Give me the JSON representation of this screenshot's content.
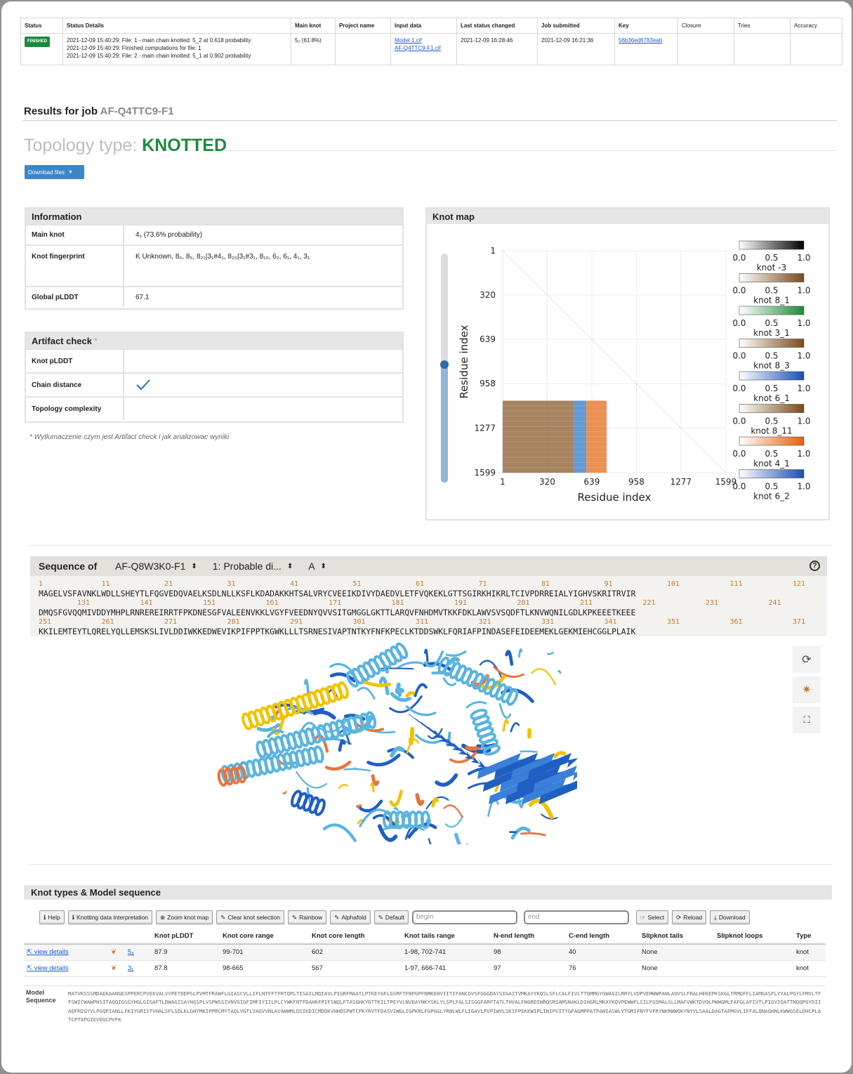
{
  "status_table": {
    "headers": [
      "Status",
      "Status Details",
      "Main knot",
      "Project name",
      "Input data",
      "Last status changed",
      "Job submitted",
      "Key",
      "Closure",
      "Tries",
      "Accuracy"
    ],
    "row": {
      "status": "FINISHED",
      "details": [
        "2021-12-09 15:40:29: File: 1 - main chain knotted: 5_2 at 0.618 probability",
        "2021-12-09 15:40:29: Finished computations for file: 1",
        "2021-12-09 15:40:29: File: 2 - main chain knotted: 5_1 at 0.902 probability"
      ],
      "main_knot": "5₂ (61.8%)",
      "project_name": "",
      "input_1": "Model 1.cif",
      "input_2": "AF-Q4TTC9-F1.cif",
      "last_changed": "2021-12-09 16:28:46",
      "submitted": "2021-12-09 16:21:36",
      "key": "56b36ed6783eab"
    }
  },
  "results": {
    "title": "Results for job",
    "job_id": "AF-Q4TTC9-F1",
    "topology_label": "Topology type:",
    "topology_value": "KNOTTED",
    "download_label": "Download files"
  },
  "information": {
    "title": "Information",
    "main_knot_label": "Main knot",
    "main_knot_value": "4₁ (73.6% probability)",
    "fingerprint_label": "Knot fingerprint",
    "fingerprint_value": "K Unknown, 8₆, 8₅, 8₂₁|3₁#4₁, 8₂₀|3₁#3₁, 8₁₀, 6₂, 6₁, 4₁, 3₁",
    "plddt_label": "Global pLDDT",
    "plddt_value": "67.1"
  },
  "artifact": {
    "title": "Artifact check",
    "star": "*",
    "rows": [
      "Knot pLDDT",
      "Chain distance",
      "Topology complexity"
    ],
    "note": "* Wytłumaczenie czym jest Artifact check i jak analizowac wyniki"
  },
  "knot_map": {
    "title": "Knot map",
    "colorbars": [
      "knot -3",
      "knot 8_1",
      "knot 3_1",
      "knot 8_3",
      "knot 6_1",
      "knot 8_11",
      "knot 4_1",
      "knot 6_2"
    ],
    "colorbar_ticks": [
      "0.0",
      "0.5",
      "1.0"
    ],
    "colorbar_colors": [
      "#000000",
      "#7a4a1e",
      "#1f8a3c",
      "#7a4a1e",
      "#1a4fb0",
      "#7a4a1e",
      "#e0620d",
      "#1a4fb0"
    ]
  },
  "chart_data": {
    "type": "heatmap",
    "xlabel": "Residue index",
    "ylabel": "Residue index",
    "xticks": [
      "1",
      "320",
      "639",
      "958",
      "1277",
      "1599"
    ],
    "yticks": [
      "1",
      "320",
      "639",
      "958",
      "1277",
      "1599"
    ],
    "xlim": [
      1,
      1599
    ],
    "ylim": [
      1,
      1599
    ],
    "regions": [
      {
        "knot": "knot 8_1",
        "x": [
          1,
          510
        ],
        "y": [
          1080,
          1599
        ],
        "color": "#8a5a2b"
      },
      {
        "knot": "knot 6_1",
        "x": [
          510,
          600
        ],
        "y": [
          1080,
          1599
        ],
        "color": "#2f78c4"
      },
      {
        "knot": "knot 4_1",
        "x": [
          600,
          745
        ],
        "y": [
          1080,
          1599
        ],
        "color": "#e56a1a"
      }
    ]
  },
  "sequence_viewer": {
    "label": "Sequence of",
    "entry": "AF-Q8W3K0-F1",
    "chain_desc": "1: Probable di...",
    "chain": "A",
    "help": "?",
    "rows": [
      {
        "nums": [
          "1",
          "11",
          "21",
          "31",
          "41",
          "51",
          "61",
          "71",
          "81",
          "91",
          "101",
          "111",
          "121"
        ],
        "seq": "MAGELVSFAVNKLWDLLSHEYTLFQGVEDQVAELKSDLNLLKSFLKDADAKKHTSALVRYCVEEIKDIVYDAEDVLETFVQKEKLGTTSGIRKHIKRLTCIVPDRREIALYIGHVSKRITRVIR"
      },
      {
        "nums": [
          "131",
          "141",
          "151",
          "161",
          "171",
          "181",
          "191",
          "201",
          "211",
          "221",
          "231",
          "241"
        ],
        "seq": "DMQSFGVQQMIVDDYMHPLRNREREIRRTFPKDNESGFVALEENVKKLVGYFVEEDNYQVVSITGMGGLGKTTLARQVFNHDMVTKKFDKLAWVSVSQDFTLKNVWQNILGDLKPKEEETKEEE"
      },
      {
        "nums": [
          "251",
          "261",
          "271",
          "281",
          "291",
          "301",
          "311",
          "321",
          "331",
          "341",
          "351",
          "361",
          "371"
        ],
        "seq": "KKILEMTEYTLQRELYQLLEMSKSLIVLDDIWKKEDWEVIKPIFPPTKGWKLLLTSRNESIVAPTNTKYFNFKPECLKTDDSWKLFQRIAFPINDASEFEIDEEMEKLGEKMIEHCGGLPLAIK"
      }
    ]
  },
  "knot_types": {
    "title": "Knot types & Model sequence",
    "buttons": [
      "Help",
      "Knotting data interpretation",
      "Zoom knot map",
      "Clear knot selection",
      "Rainbow",
      "Alphafold",
      "Default"
    ],
    "begin_placeholder": "begin",
    "end_placeholder": "end",
    "right_buttons": [
      "Select",
      "Reload",
      "Download"
    ],
    "columns": [
      "",
      "",
      "Knot pLDDT",
      "Knot core range",
      "Knot core length",
      "Knot tails range",
      "N-end length",
      "C-end length",
      "Slipknot tails",
      "Slipknot loops",
      "Type"
    ],
    "rows": [
      {
        "link": "view details",
        "knot": "5₂",
        "plddt": "87.9",
        "core": "99-701",
        "core_len": "602",
        "tails": "1-98, 702-741",
        "n_end": "98",
        "c_end": "40",
        "slip_tails": "None",
        "slip_loops": "",
        "type": "knot"
      },
      {
        "link": "view details",
        "knot": "3₁",
        "plddt": "87.8",
        "core": "98-665",
        "core_len": "567",
        "tails": "1-97, 666-741",
        "n_end": "97",
        "c_end": "76",
        "slip_tails": "None",
        "slip_loops": "",
        "type": "knot"
      }
    ],
    "model_sequence_label": "Model Sequence",
    "model_sequence": "MATVKSSSMDAEKAANGESPPERCPVEEVALVVPETDDPSLPVMTFRAWFLGIASCVLLIFLNTFFTFRTQPLTISAILMQIAVLPIGRFMAATLPTKEYGFLGSRFTFNPGPFNMKEHVIITIFANCGVSFGGGDAYSIGAITVMKAYYKQSLSFLCALFIVLTTQMMGYGWAGILRRYLVDPVEMWWPANLAQVSLFRALHEKEPKSKGLTRMQFFLIAMGASFLYYALPGYLFMVLTFFSWICWAWPHSITAQQIGSGYHGLGIGAFTLDWAGISAYHGSPLVSPWSSIVNVGIGFIMFIYIILPLCYWKFNTFDAHKFPIFSNQLFTASGHKYDTTKILTPEYVLNVDAYNKYSKLYLSPLFALSISGGFARFTATLTHVALFNGRDIWRQSRSAMSNAKLDIHGRLMKAYKQVPEWWFLSILFGSMALSLLMAFVWKTDVQLPWWGMLFAFGLAFIVTLPIGVIQATTNQQPGYDIIAQFMIGYVLPGQPIANLLFKIYGRISTVHALSFLSDLKLGHYMKIPPRCMYTAQLVGTLVAGVVNLAVAWWMLDSIKDICMDDKVHHDSPWTCPKYRVTFDASVIWGLIGPKRLFGPGGLYRNLWLFLIGAVLPVPIWVLSKIFPEKKWIPLINIPVITYGFAGMPPATPANIASWLVTGMIFNYFVFRYNKRWWQKYNYVLSAALDAGTAFMGVLIFFALQNAGHNLKWWGSELDHCPLATCPTAPGIEVDGCPVFK"
  }
}
